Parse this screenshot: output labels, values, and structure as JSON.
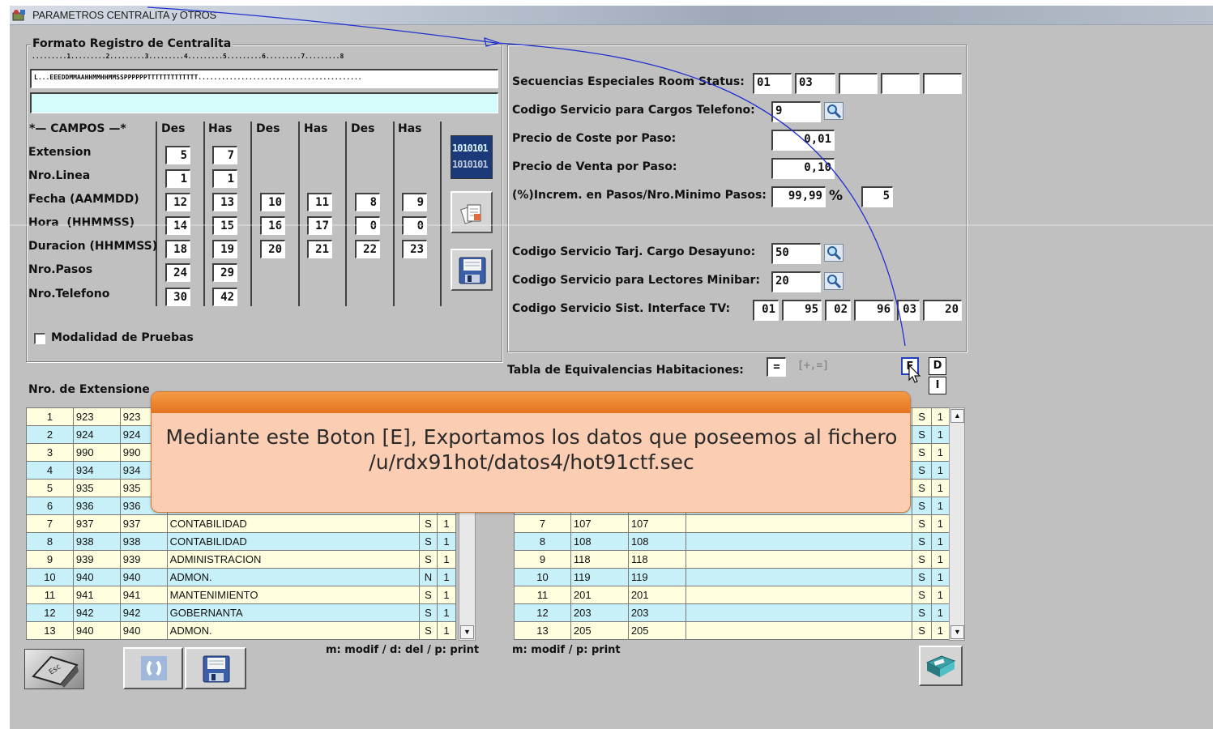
{
  "window": {
    "title": "PARAMETROS CENTRALITA y OTROS"
  },
  "formato": {
    "group_title": "Formato Registro de Centralita",
    "ruler": ".........1.........2.........3.........4.........5.........6.........7.........8",
    "format_string": "L...EEEDDMMAAHHMMHHMMSSPPPPPPTTTTTTTTTTTTT..........................................",
    "second_line": "",
    "campos_header": "*— CAMPOS —*",
    "col_headers": [
      "Des",
      "Has",
      "Des",
      "Has",
      "Des",
      "Has"
    ],
    "rows": [
      {
        "label": "Extension",
        "values": [
          "5",
          "7"
        ]
      },
      {
        "label": "Nro.Linea",
        "values": [
          "1",
          "1"
        ]
      },
      {
        "label": "Fecha (AAMMDD)",
        "values": [
          "12",
          "13",
          "10",
          "11",
          "8",
          "9"
        ]
      },
      {
        "label": "Hora  (HHMMSS)",
        "values": [
          "14",
          "15",
          "16",
          "17",
          "0",
          "0"
        ]
      },
      {
        "label": "Duracion (HHMMSS)",
        "values": [
          "18",
          "19",
          "20",
          "21",
          "22",
          "23"
        ]
      },
      {
        "label": "Nro.Pasos",
        "values": [
          "24",
          "29"
        ]
      },
      {
        "label": "Nro.Telefono",
        "values": [
          "30",
          "42"
        ]
      }
    ],
    "modalidad_label": "Modalidad de Pruebas",
    "binary_icon_text": "1010101"
  },
  "right_panel": {
    "secuencias_label": "Secuencias Especiales Room Status:",
    "secuencias_values": [
      "01",
      "03",
      "",
      "",
      ""
    ],
    "codigo_telefono_label": "Codigo Servicio para Cargos Telefono:",
    "codigo_telefono_value": "9",
    "precio_coste_label": "Precio de Coste por Paso:",
    "precio_coste_value": "0,01",
    "precio_venta_label": "Precio de Venta por Paso:",
    "precio_venta_value": "0,10",
    "incremento_label": "(%)Increm. en Pasos/Nro.Minimo Pasos:",
    "incremento_value": "99,99",
    "incremento_unit": "%",
    "minimo_pasos_value": "5",
    "desayuno_label": "Codigo Servicio Tarj. Cargo Desayuno:",
    "desayuno_value": "50",
    "minibar_label": "Codigo Servicio para Lectores Minibar:",
    "minibar_value": "20",
    "tv_label": "Codigo Servicio Sist. Interface TV:",
    "tv_values": [
      "01",
      "95",
      "02",
      "96",
      "03",
      "20"
    ]
  },
  "equivalencias": {
    "label": "Tabla de Equivalencias Habitaciones:",
    "eq_value": "=",
    "hint": "[+,=]",
    "btn_e": "E",
    "btn_d": "D",
    "btn_i": "I"
  },
  "extensiones": {
    "label": "Nro. de Extensione",
    "rows": [
      {
        "n": "1",
        "a": "923",
        "b": "923",
        "name": "",
        "s": "",
        "v": ""
      },
      {
        "n": "2",
        "a": "924",
        "b": "924",
        "name": "",
        "s": "",
        "v": ""
      },
      {
        "n": "3",
        "a": "990",
        "b": "990",
        "name": "",
        "s": "",
        "v": ""
      },
      {
        "n": "4",
        "a": "934",
        "b": "934",
        "name": "",
        "s": "",
        "v": ""
      },
      {
        "n": "5",
        "a": "935",
        "b": "935",
        "name": "",
        "s": "",
        "v": ""
      },
      {
        "n": "6",
        "a": "936",
        "b": "936",
        "name": "",
        "s": "",
        "v": ""
      },
      {
        "n": "7",
        "a": "937",
        "b": "937",
        "name": "CONTABILIDAD",
        "s": "S",
        "v": "1"
      },
      {
        "n": "8",
        "a": "938",
        "b": "938",
        "name": "CONTABILIDAD",
        "s": "S",
        "v": "1"
      },
      {
        "n": "9",
        "a": "939",
        "b": "939",
        "name": "ADMINISTRACION",
        "s": "S",
        "v": "1"
      },
      {
        "n": "10",
        "a": "940",
        "b": "940",
        "name": "ADMON.",
        "s": "N",
        "v": "1"
      },
      {
        "n": "11",
        "a": "941",
        "b": "941",
        "name": "MANTENIMIENTO",
        "s": "S",
        "v": "1"
      },
      {
        "n": "12",
        "a": "942",
        "b": "942",
        "name": "GOBERNANTA",
        "s": "S",
        "v": "1"
      },
      {
        "n": "13",
        "a": "940",
        "b": "940",
        "name": "ADMON.",
        "s": "S",
        "v": "1"
      }
    ],
    "hint": "m: modif / d: del / p: print"
  },
  "habitaciones": {
    "rows": [
      {
        "n": "",
        "a": "",
        "b": "",
        "name": "",
        "s": "S",
        "v": "1"
      },
      {
        "n": "",
        "a": "",
        "b": "",
        "name": "",
        "s": "S",
        "v": "1"
      },
      {
        "n": "",
        "a": "",
        "b": "",
        "name": "",
        "s": "S",
        "v": "1"
      },
      {
        "n": "",
        "a": "",
        "b": "",
        "name": "",
        "s": "S",
        "v": "1"
      },
      {
        "n": "",
        "a": "",
        "b": "",
        "name": "",
        "s": "S",
        "v": "1"
      },
      {
        "n": "",
        "a": "",
        "b": "",
        "name": "",
        "s": "S",
        "v": "1"
      },
      {
        "n": "7",
        "a": "107",
        "b": "107",
        "name": "",
        "s": "S",
        "v": "1"
      },
      {
        "n": "8",
        "a": "108",
        "b": "108",
        "name": "",
        "s": "S",
        "v": "1"
      },
      {
        "n": "9",
        "a": "118",
        "b": "118",
        "name": "",
        "s": "S",
        "v": "1"
      },
      {
        "n": "10",
        "a": "119",
        "b": "119",
        "name": "",
        "s": "S",
        "v": "1"
      },
      {
        "n": "11",
        "a": "201",
        "b": "201",
        "name": "",
        "s": "S",
        "v": "1"
      },
      {
        "n": "12",
        "a": "203",
        "b": "203",
        "name": "",
        "s": "S",
        "v": "1"
      },
      {
        "n": "13",
        "a": "205",
        "b": "205",
        "name": "",
        "s": "S",
        "v": "1"
      }
    ],
    "hint": "m: modif / p: print"
  },
  "callout": {
    "text_line1": "Mediante este Boton [E], Exportamos los datos que poseemos al fichero",
    "text_line2": "/u/rdx91hot/datos4/hot91ctf.sec"
  },
  "colors": {
    "window_bg": "#c0c0c0",
    "row_yellow": "#ffffe0",
    "row_cyan": "#c8f0f8",
    "callout_head": "#f0882f",
    "callout_body": "#fbcdb2",
    "annotation_line": "#2030d0"
  },
  "icons": [
    "app-icon",
    "binary-icon",
    "docs-icon",
    "floppy-save-icon",
    "magnifier-icon",
    "esc-key-icon",
    "refresh-icon",
    "printer-icon",
    "mouse-cursor-icon"
  ]
}
